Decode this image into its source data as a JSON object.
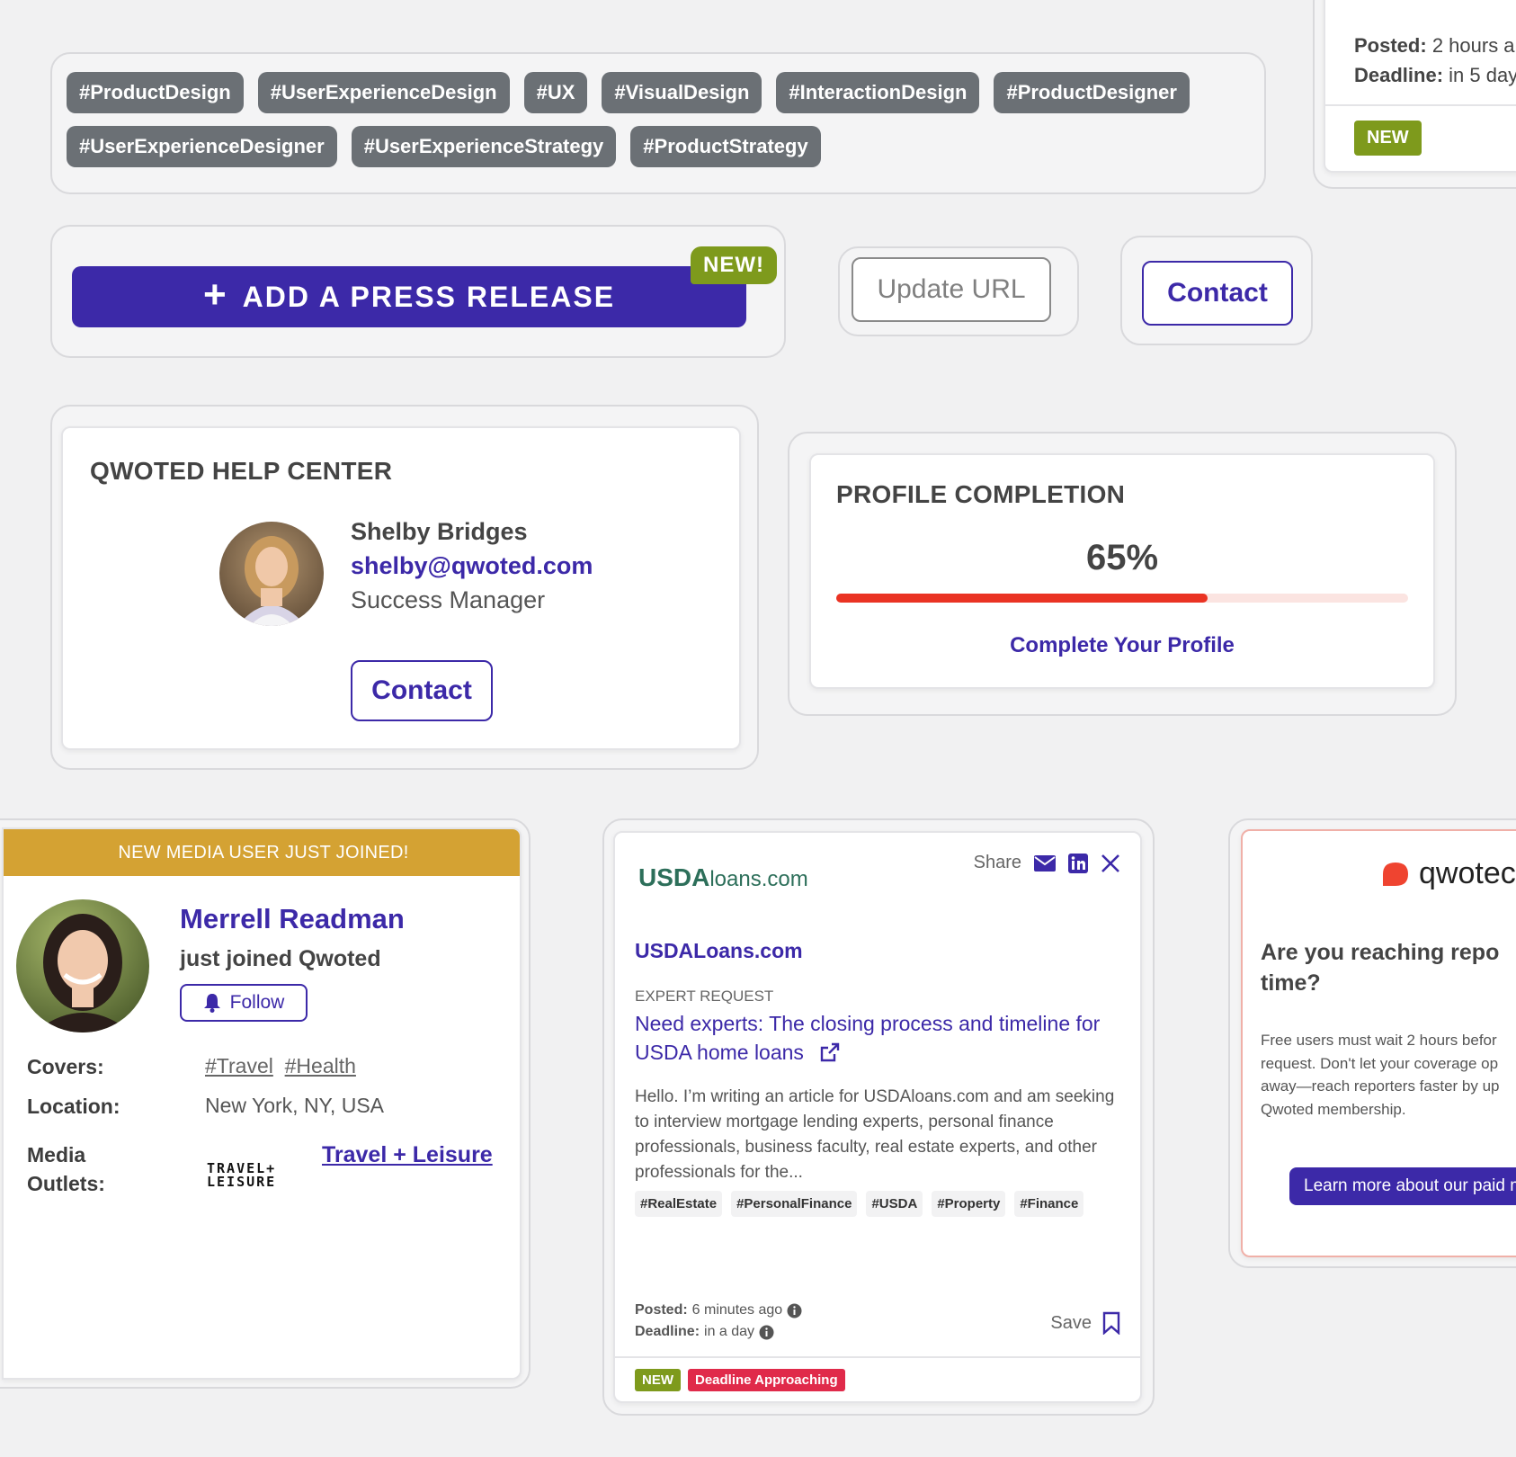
{
  "hashtags": [
    "#ProductDesign",
    "#UserExperienceDesign",
    "#UX",
    "#VisualDesign",
    "#InteractionDesign",
    "#ProductDesigner",
    "#UserExperienceDesigner",
    "#UserExperienceStrategy",
    "#ProductStrategy"
  ],
  "top_right_card": {
    "posted_label": "Posted:",
    "posted_value": "2 hours a",
    "deadline_label": "Deadline:",
    "deadline_value": "in 5 day",
    "badge": "NEW"
  },
  "press_release": {
    "button_label": "ADD A PRESS RELEASE",
    "plus": "+",
    "new_flag": "NEW!"
  },
  "update_url_button": "Update URL",
  "contact_button_top": "Contact",
  "help_center": {
    "title": "QWOTED HELP CENTER",
    "name": "Shelby Bridges",
    "email": "shelby@qwoted.com",
    "role": "Success Manager",
    "contact_button": "Contact"
  },
  "profile_completion": {
    "title": "PROFILE COMPLETION",
    "percent_label": "65%",
    "progress": 0.65,
    "link": "Complete Your Profile",
    "fill_color": "#ea3323",
    "track_color": "#fbe4e1"
  },
  "media_user": {
    "banner": "NEW MEDIA USER JUST JOINED!",
    "name": "Merrell Readman",
    "subtitle": "just joined Qwoted",
    "follow_button": "Follow",
    "covers_label": "Covers:",
    "covers": [
      "#Travel",
      "#Health"
    ],
    "location_label": "Location:",
    "location": "New York, NY, USA",
    "outlets_label_1": "Media",
    "outlets_label_2": "Outlets:",
    "outlet_logo_line1": "TRAVEL+",
    "outlet_logo_line2": "LEISURE",
    "outlet_link": "Travel + Leisure"
  },
  "expert_request": {
    "logo_bold": "USDA",
    "logo_light": "loans.com",
    "share_label": "Share",
    "company": "USDALoans.com",
    "category": "EXPERT REQUEST",
    "headline": "Need experts: The closing process and timeline for USDA home loans",
    "body": "Hello. I’m writing an article for USDAloans.com and am seeking to interview mortgage lending experts, personal finance professionals, business faculty, real estate experts, and other professionals for the...",
    "tags": [
      "#RealEstate",
      "#PersonalFinance",
      "#USDA",
      "#Property",
      "#Finance"
    ],
    "posted_label": "Posted:",
    "posted_value": "6 minutes ago",
    "deadline_label": "Deadline:",
    "deadline_value": "in a day",
    "save_label": "Save",
    "badge_new": "NEW",
    "badge_deadline": "Deadline Approaching"
  },
  "qwoted_ad": {
    "brand": "qwotec",
    "heading": "Are you reaching repo time?",
    "body": "Free users must wait 2 hours befor request. Don't let your coverage op away—reach reporters faster by up Qwoted membership.",
    "button": "Learn more about our paid m"
  },
  "colors": {
    "brand_purple": "#3c29a8",
    "green_badge": "#7e9a1c",
    "banner_gold": "#d4a233",
    "deadline_red": "#e02a4a"
  }
}
